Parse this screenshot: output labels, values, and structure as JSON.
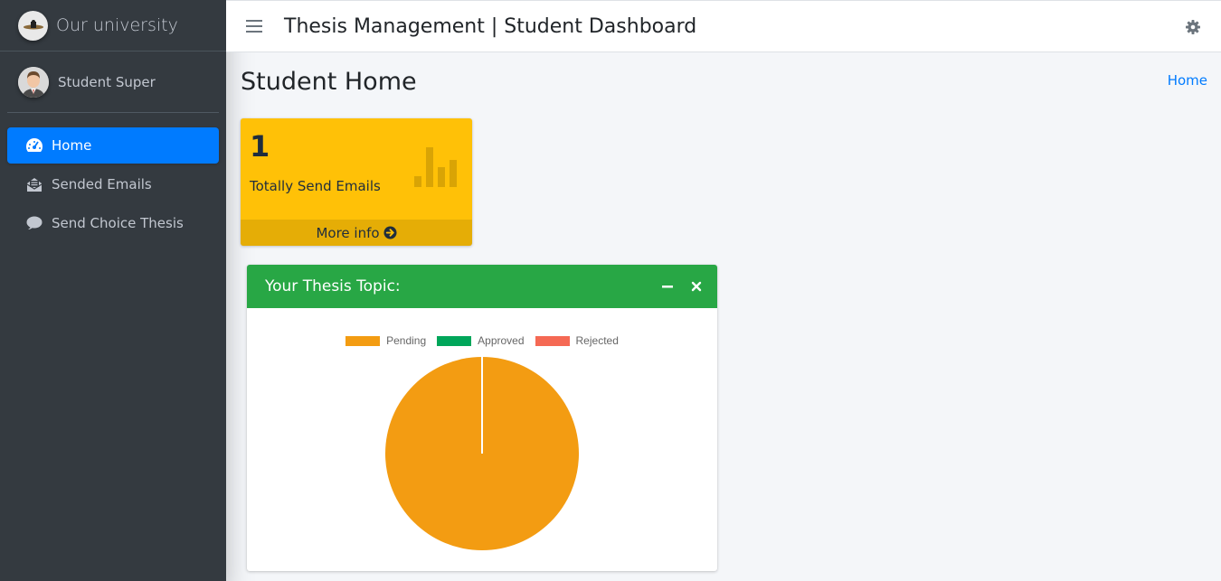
{
  "brand": {
    "name": "Our university"
  },
  "user": {
    "name": "Student Super"
  },
  "sidebar": {
    "items": [
      {
        "label": "Home",
        "icon": "tachometer-icon",
        "active": true
      },
      {
        "label": "Sended Emails",
        "icon": "envelope-open-icon",
        "active": false
      },
      {
        "label": "Send Choice Thesis",
        "icon": "comment-icon",
        "active": false
      }
    ]
  },
  "header": {
    "title": "Thesis Management | Student Dashboard"
  },
  "page": {
    "title": "Student Home",
    "breadcrumb": "Home"
  },
  "small_box": {
    "count": "1",
    "label": "Totally Send Emails",
    "footer": "More info",
    "color": "#ffc107",
    "icon": "bar-chart-icon"
  },
  "card": {
    "title": "Your Thesis Topic:",
    "color": "#28a745"
  },
  "chart_data": {
    "type": "pie",
    "categories": [
      "Pending",
      "Approved",
      "Rejected"
    ],
    "values": [
      1,
      0,
      0
    ],
    "colors": [
      "#f39c12",
      "#00a65a",
      "#f56954"
    ],
    "legend": "top"
  }
}
